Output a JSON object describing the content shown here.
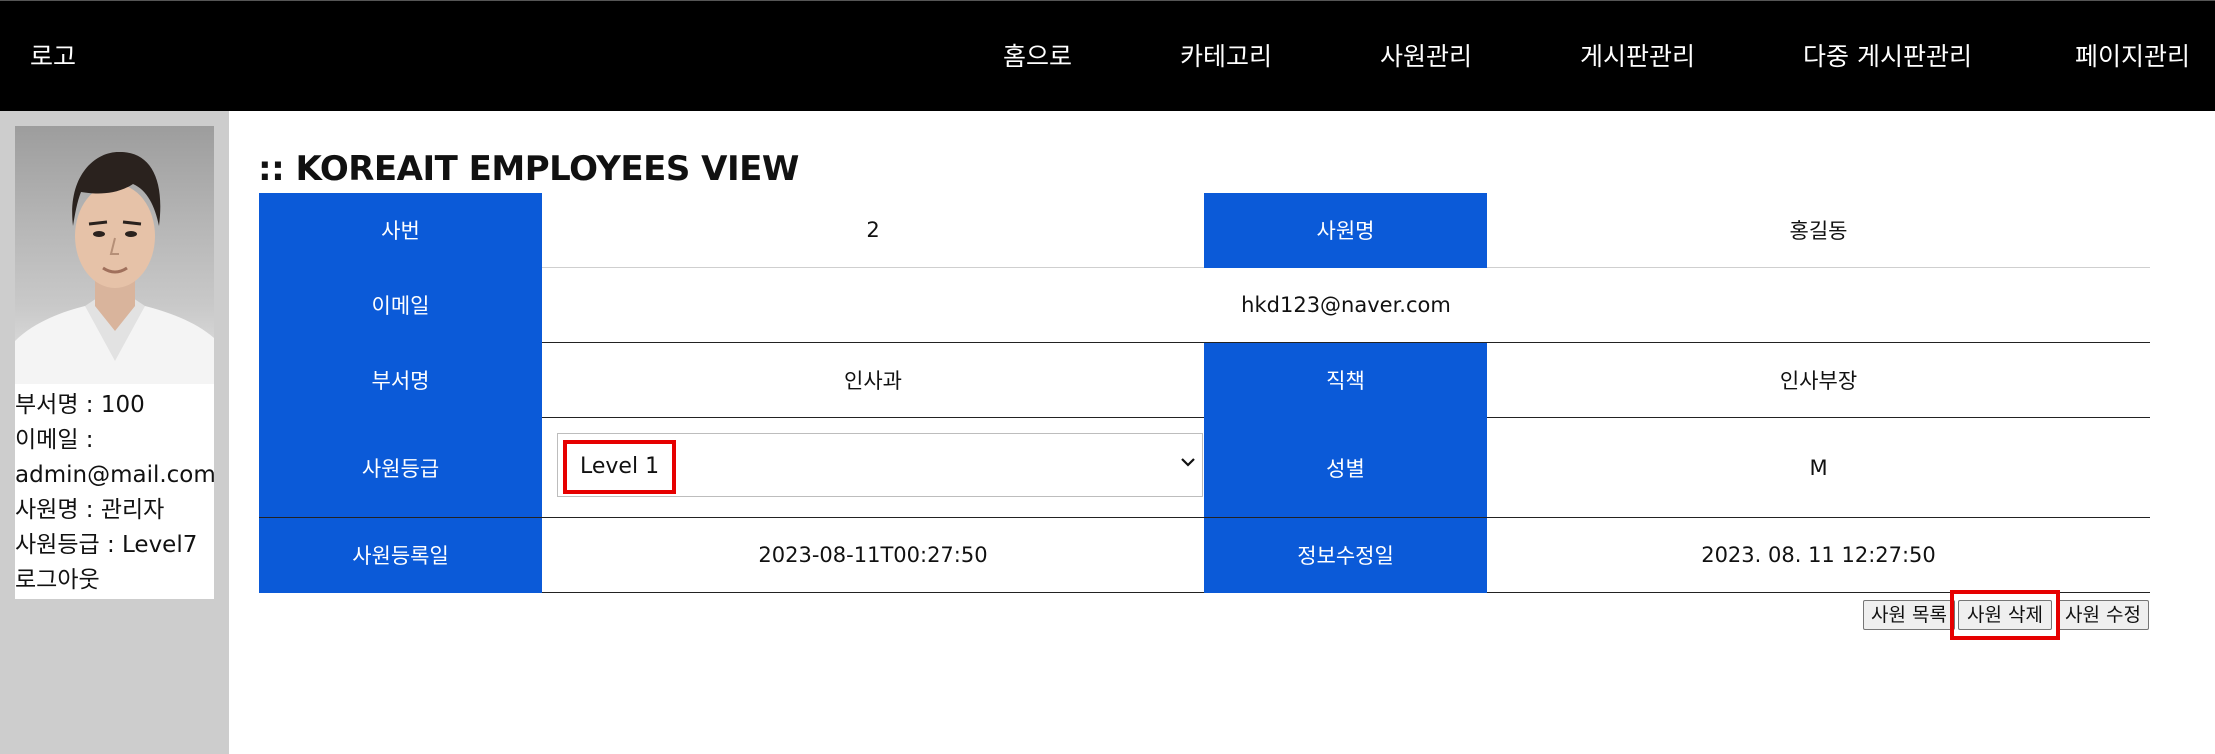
{
  "header": {
    "logo": "로고",
    "nav": [
      {
        "label": "홈으로"
      },
      {
        "label": "카테고리"
      },
      {
        "label": "사원관리"
      },
      {
        "label": "게시판관리"
      },
      {
        "label": "다중 게시판관리"
      },
      {
        "label": "페이지관리"
      }
    ]
  },
  "sidebar": {
    "profile": {
      "dept_line": "부서명 : 100",
      "email_label": "이메일 :",
      "email_value": "admin@mail.com",
      "name_line": "사원명 : 관리자",
      "grade_line": "사원등급 : Level7",
      "logout": "로그아웃"
    }
  },
  "main": {
    "title": ":: KOREAIT EMPLOYEES VIEW",
    "table": {
      "emp_no_label": "사번",
      "emp_no_value": "2",
      "emp_name_label": "사원명",
      "emp_name_value": "홍길동",
      "email_label": "이메일",
      "email_value": "hkd123@naver.com",
      "dept_label": "부서명",
      "dept_value": "인사과",
      "position_label": "직책",
      "position_value": "인사부장",
      "grade_label": "사원등급",
      "grade_value": "Level 1",
      "gender_label": "성별",
      "gender_value": "M",
      "reg_date_label": "사원등록일",
      "reg_date_value": "2023-08-11T00:27:50",
      "mod_date_label": "정보수정일",
      "mod_date_value": "2023. 08. 11 12:27:50"
    },
    "buttons": {
      "list": "사원 목록",
      "delete": "사원 삭제",
      "edit": "사원 수정"
    }
  },
  "colors": {
    "header_bg": "#000000",
    "sidebar_bg": "#cdcdcd",
    "table_header_bg": "#0b5ad8",
    "highlight": "#e60000"
  }
}
